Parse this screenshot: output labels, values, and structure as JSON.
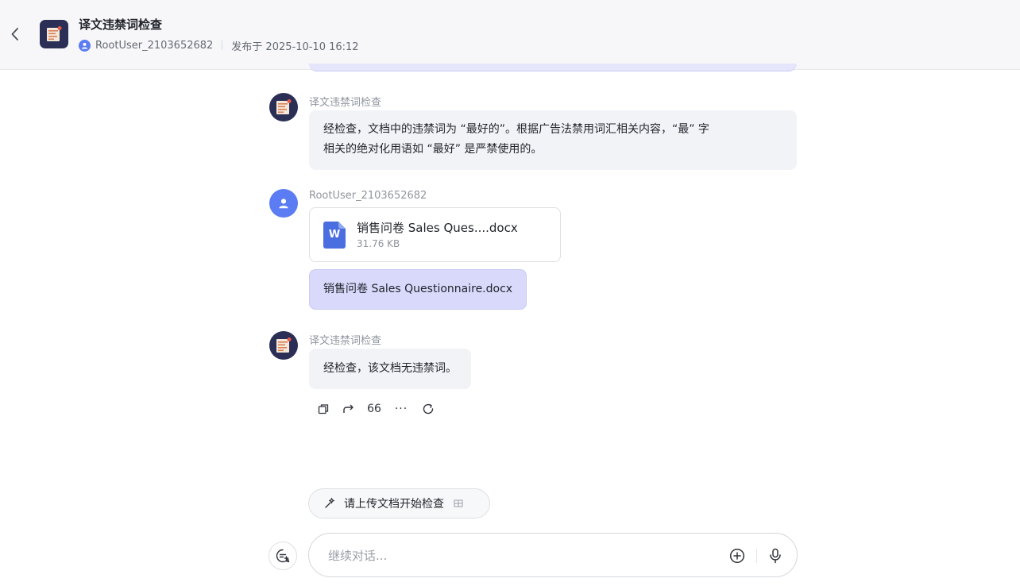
{
  "header": {
    "title": "译文违禁词检查",
    "user": "RootUser_2103652682",
    "published": "发布于 2025-10-10 16:12"
  },
  "messages": [
    {
      "sender": "译文违禁词检查",
      "text_line1": "经检查，文档中的违禁词为 “最好的”。根据广告法禁用词汇相关内容，“最” 字",
      "text_line2": "相关的绝对化用语如 “最好” 是严禁使用的。"
    },
    {
      "sender": "RootUser_2103652682",
      "file_name": "销售问卷 Sales Ques....docx",
      "file_size": "31.76 KB",
      "file_icon_letter": "W",
      "text": "销售问卷 Sales Questionnaire.docx"
    },
    {
      "sender": "译文违禁词检查",
      "text": "经检查，该文档无违禁词。"
    }
  ],
  "actions": {
    "quote_label": "66",
    "more_label": "···"
  },
  "suggestion": {
    "label": "请上传文档开始检查"
  },
  "input": {
    "placeholder": "继续对话..."
  },
  "colors": {
    "accent": "#5b7cf2",
    "bot_avatar": "#2b2f55",
    "user_bubble": "#d8d9fb",
    "bot_bubble": "#f2f3f7",
    "word_icon": "#4a6ee0"
  },
  "icons": {
    "back": "chevron-left-icon",
    "logo": "document-check-icon",
    "copy": "copy-icon",
    "share": "share-icon",
    "refresh": "refresh-icon",
    "sparkle": "sparkle-icon",
    "new_chat": "new-chat-icon",
    "plus": "plus-circle-icon",
    "mic": "microphone-icon"
  }
}
